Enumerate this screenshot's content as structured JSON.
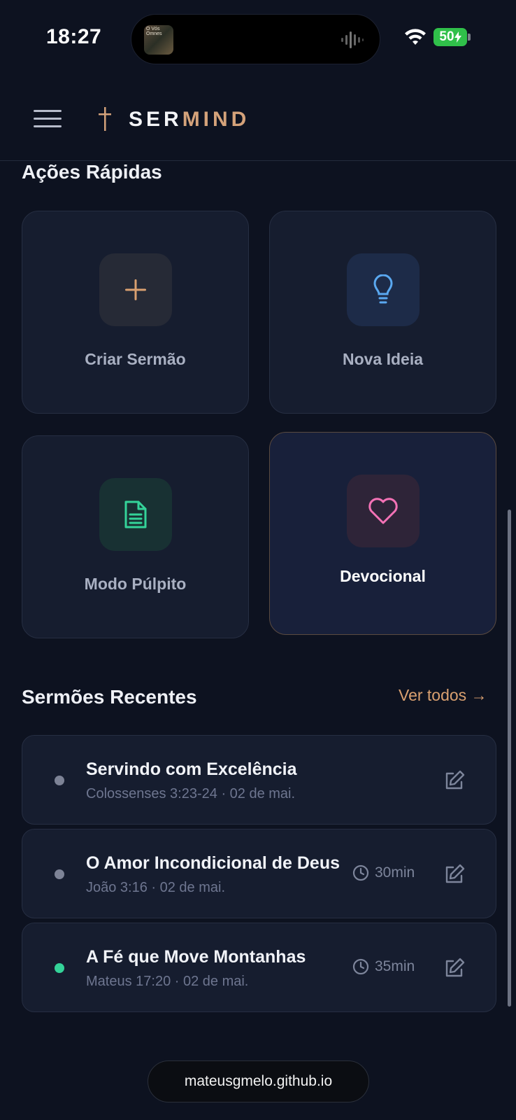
{
  "status_bar": {
    "time": "18:27",
    "now_playing_art_text": "O Vós Omnes",
    "battery": "50"
  },
  "header": {
    "brand_part1": "SER",
    "brand_part2": "MIND"
  },
  "quick_actions": {
    "title": "Ações Rápidas",
    "items": [
      {
        "label": "Criar Sermão",
        "icon": "plus-icon",
        "color": "#d9a070"
      },
      {
        "label": "Nova Ideia",
        "icon": "lightbulb-icon",
        "color": "#5aa8f0"
      },
      {
        "label": "Modo Púlpito",
        "icon": "document-icon",
        "color": "#34d399"
      },
      {
        "label": "Devocional",
        "icon": "heart-icon",
        "color": "#f472b6"
      }
    ]
  },
  "recent_sermons": {
    "title": "Sermões Recentes",
    "see_all": "Ver todos →",
    "items": [
      {
        "title": "Servindo com Excelência",
        "meta": "Colossenses 3:23-24 · 02 de mai.",
        "duration": "",
        "dot_color": "#7d8396"
      },
      {
        "title": "O Amor Incondicional de Deus",
        "meta": "João 3:16 · 02 de mai.",
        "duration": "30min",
        "dot_color": "#7d8396"
      },
      {
        "title": "A Fé que Move Montanhas",
        "meta": "Mateus 17:20 · 02 de mai.",
        "duration": "35min",
        "dot_color": "#34d399"
      }
    ]
  },
  "browser": {
    "url": "mateusgmelo.github.io"
  }
}
